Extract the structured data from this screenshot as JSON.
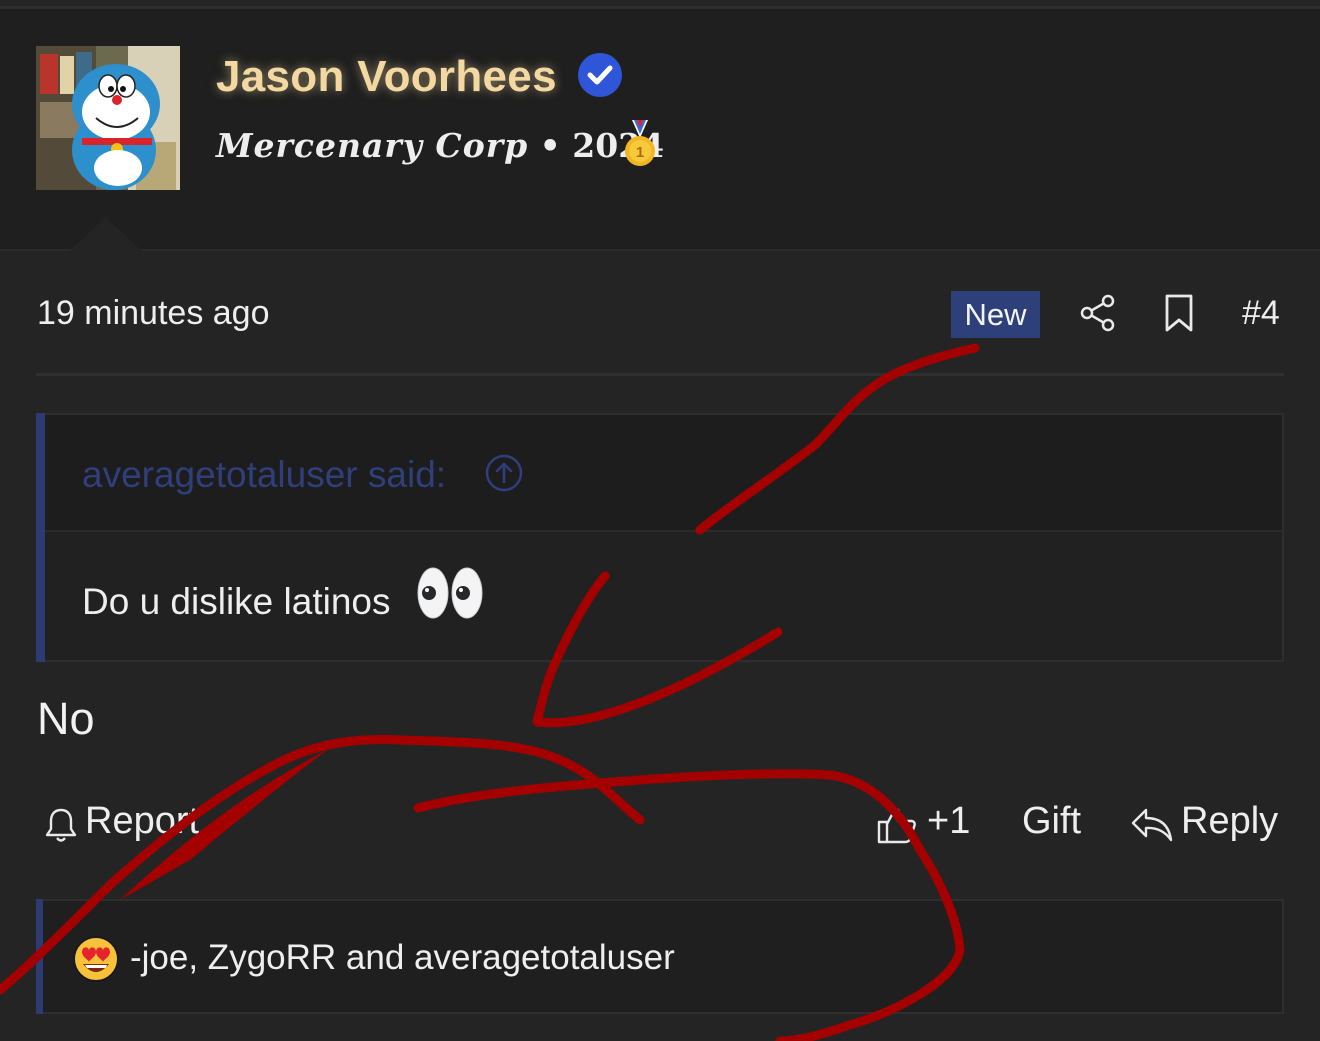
{
  "user": {
    "name": "Jason Voorhees",
    "title_text": "Mercenary Corp",
    "separator": "•",
    "year": "2024",
    "verified_icon": "verified-check-icon",
    "medal_icon": "gold-medal-icon"
  },
  "post": {
    "timestamp": "19 minutes ago",
    "new_badge": "New",
    "number": "#4",
    "body": "No"
  },
  "quote": {
    "author": "averagetotaluser said:",
    "text": "Do u dislike latinos"
  },
  "actions": {
    "report": "Report",
    "like": "+1",
    "gift": "Gift",
    "reply": "Reply"
  },
  "reactions": {
    "summary": "-joe, ZygoRR and averagetotaluser"
  },
  "colors": {
    "background": "#242424",
    "header": "#1f1f1f",
    "accent": "#2d4079",
    "username": "#f3d8a1",
    "scribble": "#a50000"
  }
}
